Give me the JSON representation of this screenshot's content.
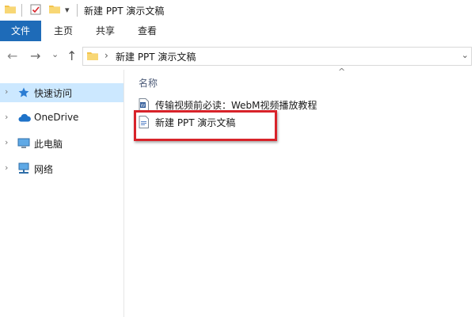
{
  "titlebar": {
    "title": "新建 PPT 演示文稿",
    "dropdown_glyph": "▾"
  },
  "ribbon": {
    "file_tab": "文件",
    "tabs": [
      "主页",
      "共享",
      "查看"
    ],
    "file_tab_color": "#1e6bb8"
  },
  "address_bar": {
    "back_glyph": "←",
    "forward_glyph": "→",
    "recent_glyph": "⌄",
    "up_glyph": "↑",
    "separator_glyph": "›",
    "path": "新建 PPT 演示文稿",
    "dropdown_glyph": "⌄"
  },
  "nav_pane": {
    "items": [
      {
        "label": "快速访问",
        "icon": "star-icon",
        "selected": true
      },
      {
        "label": "OneDrive",
        "icon": "cloud-icon",
        "selected": false
      },
      {
        "label": "此电脑",
        "icon": "computer-icon",
        "selected": false
      },
      {
        "label": "网络",
        "icon": "network-icon",
        "selected": false
      }
    ],
    "expand_glyph": "›",
    "selected_color": "#cce8ff"
  },
  "file_list": {
    "sort_glyph": "^",
    "column_header": "名称",
    "files": [
      {
        "name": "传输视频前必读：WebM视频播放教程",
        "icon": "word-document-icon"
      },
      {
        "name": "新建 PPT 演示文稿",
        "icon": "document-icon"
      }
    ]
  },
  "annotation": {
    "highlight_color": "#d8232a"
  }
}
